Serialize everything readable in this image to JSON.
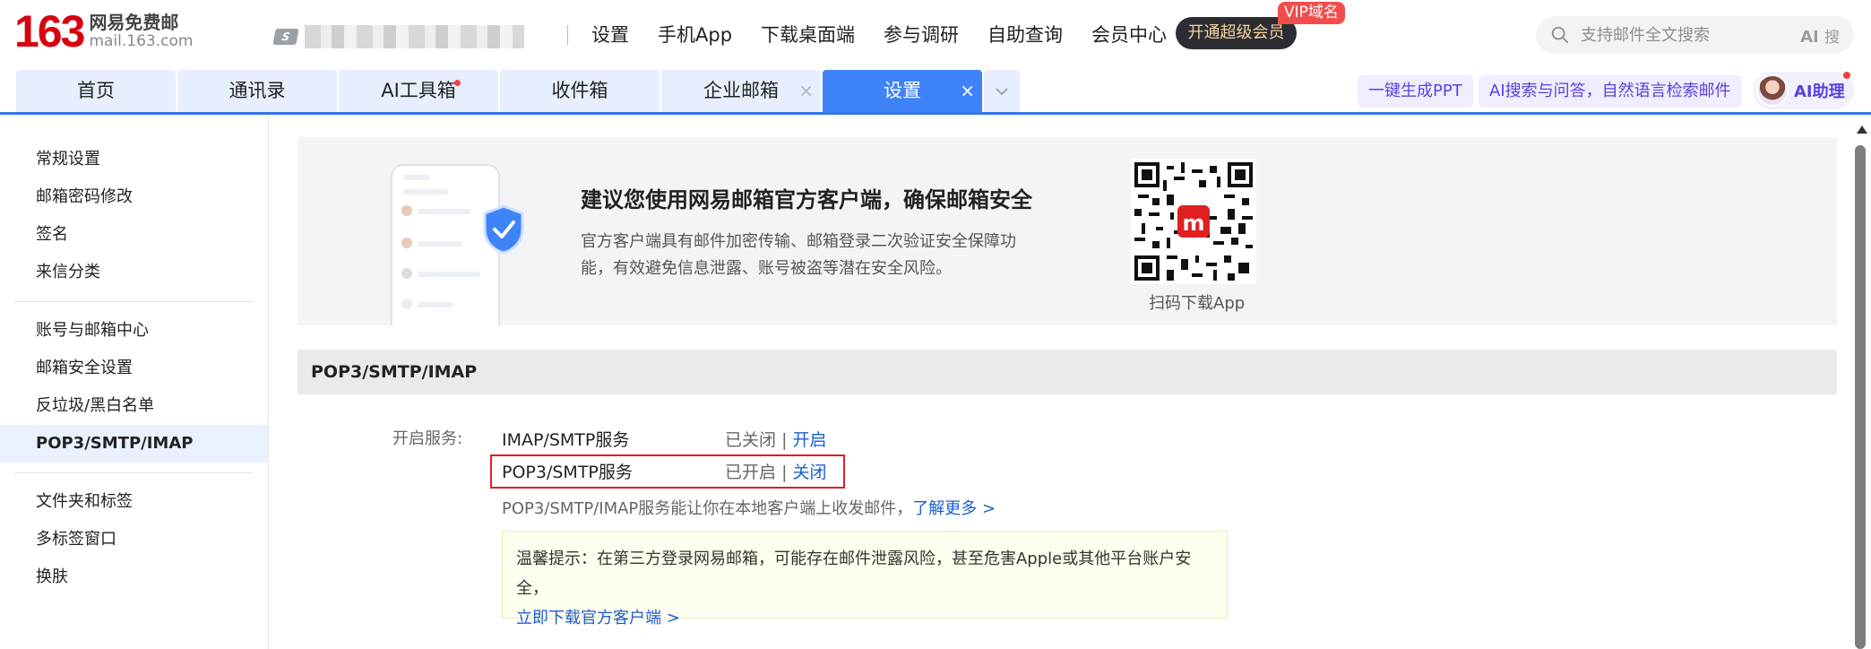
{
  "header": {
    "logo_number": "163",
    "logo_cn": "网易免费邮",
    "logo_en": "mail.163.com",
    "account_badge": "S",
    "nav": [
      "设置",
      "手机App",
      "下载桌面端",
      "参与调研",
      "自助查询",
      "会员中心"
    ],
    "vip_button": "开通超级会员",
    "vip_tag": "VIP域名",
    "search_placeholder": "支持邮件全文搜索",
    "search_ai": "AI",
    "search_ai_suffix": "搜"
  },
  "tabs": [
    {
      "label": "首页",
      "active": false,
      "closable": false,
      "dot": false
    },
    {
      "label": "通讯录",
      "active": false,
      "closable": false,
      "dot": false
    },
    {
      "label": "AI工具箱",
      "active": false,
      "closable": false,
      "dot": true
    },
    {
      "label": "收件箱",
      "active": false,
      "closable": false,
      "dot": false
    },
    {
      "label": "企业邮箱",
      "active": false,
      "closable": true,
      "dot": false
    },
    {
      "label": "设置",
      "active": true,
      "closable": true,
      "dot": false
    }
  ],
  "tab_close_glyph": "×",
  "actions": {
    "ppt": "一键生成PPT",
    "ai_search": "AI搜索与问答，自然语言检索邮件",
    "ai_assistant": "AI助理"
  },
  "sidebar": {
    "group1": [
      "常规设置",
      "邮箱密码修改",
      "签名",
      "来信分类"
    ],
    "group2": [
      "账号与邮箱中心",
      "邮箱安全设置",
      "反垃圾/黑白名单",
      "POP3/SMTP/IMAP"
    ],
    "group3": [
      "文件夹和标签",
      "多标签窗口",
      "换肤"
    ],
    "active": "POP3/SMTP/IMAP"
  },
  "banner": {
    "title": "建议您使用网易邮箱官方客户端，确保邮箱安全",
    "desc": "官方客户端具有邮件加密传输、邮箱登录二次验证安全保障功能，有效避免信息泄露、账号被盗等潜在安全风险。",
    "qr_caption": "扫码下载App"
  },
  "section": {
    "title": "POP3/SMTP/IMAP",
    "label": "开启服务:",
    "services": [
      {
        "name": "IMAP/SMTP服务",
        "status": "已关闭",
        "action": "开启"
      },
      {
        "name": "POP3/SMTP服务",
        "status": "已开启",
        "action": "关闭"
      }
    ],
    "separator": "|",
    "desc": "POP3/SMTP/IMAP服务能让你在本地客户端上收发邮件，",
    "learn_more": "了解更多 >",
    "tip_text": "温馨提示：在第三方登录网易邮箱，可能存在邮件泄露风险，甚至危害Apple或其他平台账户安全，",
    "tip_link": "立即下载官方客户端 >"
  },
  "colors": {
    "brand_red": "#d7000f",
    "tab_active": "#3f83f8",
    "link": "#1a5fd0",
    "highlight": "#e02020"
  }
}
